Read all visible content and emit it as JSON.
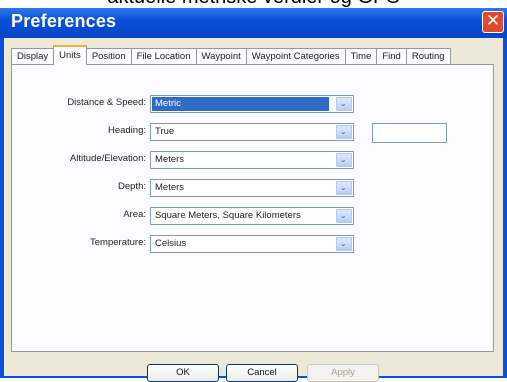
{
  "background_text": "aktuelle metriske verdier og GPS",
  "window": {
    "title": "Preferences",
    "close_glyph": "✕"
  },
  "tabs": [
    {
      "label": "Display",
      "active": false
    },
    {
      "label": "Units",
      "active": true
    },
    {
      "label": "Position",
      "active": false
    },
    {
      "label": "File Location",
      "active": false
    },
    {
      "label": "Waypoint",
      "active": false
    },
    {
      "label": "Waypoint Categories",
      "active": false
    },
    {
      "label": "Time",
      "active": false
    },
    {
      "label": "Find",
      "active": false
    },
    {
      "label": "Routing",
      "active": false
    }
  ],
  "fields": {
    "distance_speed": {
      "label": "Distance & Speed:",
      "value": "Metric"
    },
    "heading": {
      "label": "Heading:",
      "value": "True",
      "extra_value": ""
    },
    "altitude": {
      "label": "Altitude/Elevation:",
      "value": "Meters"
    },
    "depth": {
      "label": "Depth:",
      "value": "Meters"
    },
    "area": {
      "label": "Area:",
      "value": "Square Meters, Square Kilometers"
    },
    "temperature": {
      "label": "Temperature:",
      "value": "Celsius"
    }
  },
  "buttons": {
    "ok": "OK",
    "cancel": "Cancel",
    "apply": "Apply"
  },
  "icons": {
    "dropdown_arrow": "⌄",
    "dropdown_icon_name": "chevron-down-icon"
  },
  "colors": {
    "title_bar": "#0a50d6",
    "close_button": "#e0492b",
    "selection": "#316ac5",
    "active_tab_accent": "#f0b03c"
  }
}
